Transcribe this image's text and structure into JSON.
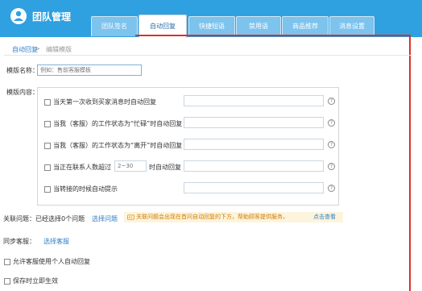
{
  "header": {
    "title": "团队管理",
    "tabs": [
      {
        "label": "团队签名"
      },
      {
        "label": "自动回复"
      },
      {
        "label": "快捷短语"
      },
      {
        "label": "禁用语"
      },
      {
        "label": "商品推荐"
      },
      {
        "label": "消息设置"
      }
    ],
    "active_tab": 1
  },
  "breadcrumb": {
    "link": "自动回复",
    "sep": ">",
    "current": "编辑模版"
  },
  "template_name": {
    "label": "模版名称：",
    "placeholder": "例如：售前客服模板"
  },
  "template_content": {
    "label": "模版内容：",
    "rows": [
      {
        "text": "当天第一次收到买家消息时自动回复"
      },
      {
        "text": "当我（客服）的工作状态为“忙碌”时自动回复"
      },
      {
        "text": "当我（客服）的工作状态为“离开”时自动回复"
      },
      {
        "text_before": "当正在联系人数超过",
        "count_placeholder": "2~30",
        "text_after": "时自动回复"
      },
      {
        "text": "当转接的时候自动提示"
      }
    ],
    "help_glyph": "?"
  },
  "related": {
    "label": "关联问题：",
    "count_text": "已经选择0个问题",
    "select_link": "选择问题",
    "notice_text": "关联问题会出现在首问自动回复的下方，帮助顾客提供服务，",
    "notice_link": "点击查看"
  },
  "sync": {
    "label": "同步客服：",
    "link": "选择客服"
  },
  "options": [
    {
      "label": "允许客服使用个人自动回复"
    },
    {
      "label": "保存时立即生效"
    }
  ],
  "colors": {
    "header": "#2fa0e0",
    "accent": "#2f80c8",
    "annotation": "#d9302a",
    "notice_bg": "#fcf4dd",
    "notice_text": "#d07b00"
  }
}
